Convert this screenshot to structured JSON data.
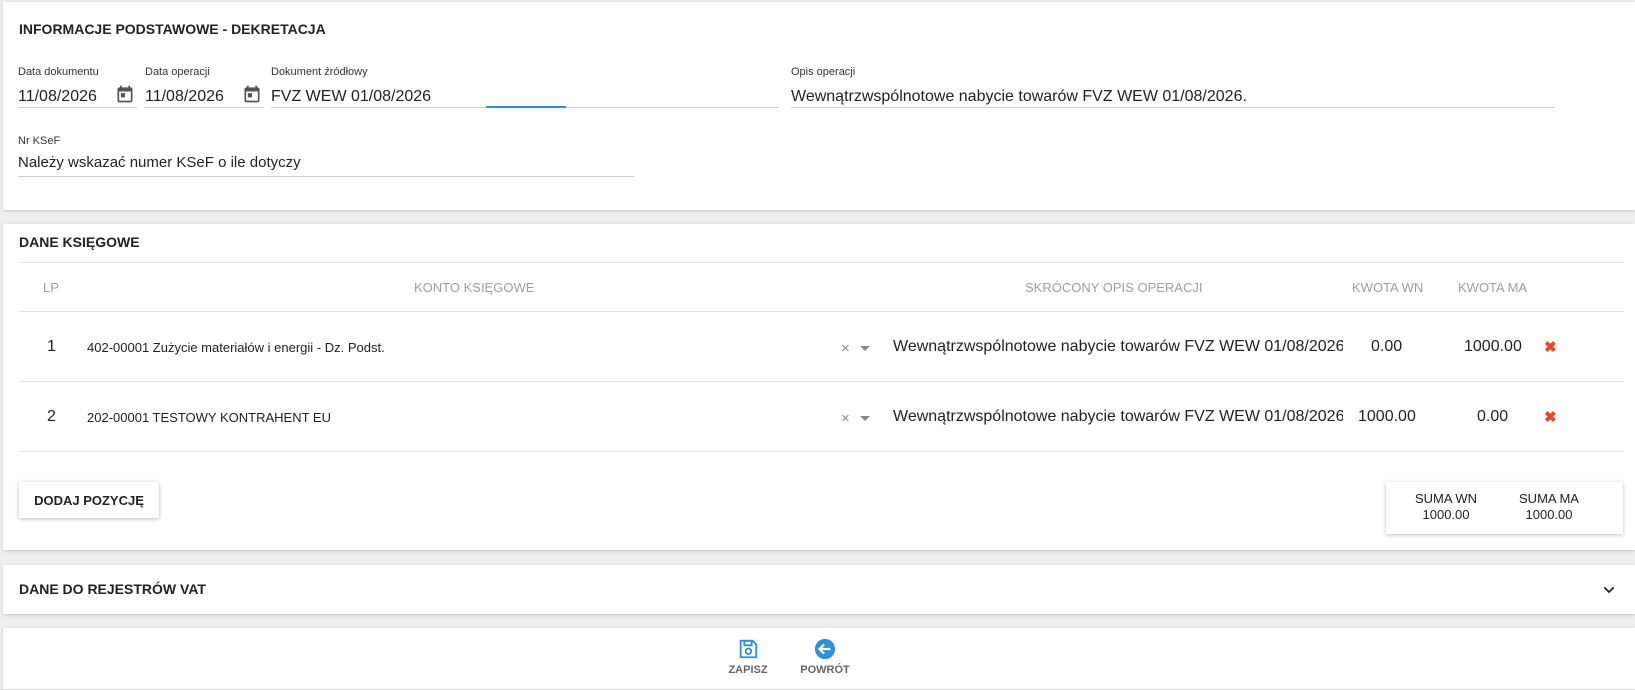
{
  "basic_info": {
    "title": "INFORMACJE PODSTAWOWE - DEKRETACJA",
    "doc_date": {
      "label": "Data dokumentu",
      "value": "11/08/2026"
    },
    "op_date": {
      "label": "Data operacji",
      "value": "11/08/2026"
    },
    "source_doc": {
      "label": "Dokument źródłowy",
      "value": "FVZ WEW 01/08/2026"
    },
    "op_desc": {
      "label": "Opis operacji",
      "value": "Wewnątrzwspólnotowe nabycie towarów FVZ WEW 01/08/2026."
    },
    "ksef": {
      "label": "Nr KSeF",
      "placeholder": "Należy wskazać numer KSeF o ile dotyczy"
    }
  },
  "accounting": {
    "title": "DANE KSIĘGOWE",
    "columns": {
      "lp": "LP",
      "account": "KONTO KSIĘGOWE",
      "desc": "SKRÓCONY OPIS OPERACJI",
      "wn": "KWOTA WN",
      "ma": "KWOTA MA"
    },
    "rows": [
      {
        "lp": "1",
        "account": "402-00001 Zużycie materiałów i energii - Dz. Podst.",
        "desc": "Wewnątrzwspólnotowe nabycie towarów FVZ WEW 01/08/2026.",
        "wn": "0.00",
        "ma": "1000.00"
      },
      {
        "lp": "2",
        "account": "202-00001 TESTOWY KONTRAHENT EU",
        "desc": "Wewnątrzwspólnotowe nabycie towarów FVZ WEW 01/08/2026.",
        "wn": "1000.00",
        "ma": "0.00"
      }
    ],
    "add_button": "DODAJ POZYCJĘ",
    "sum_wn_label": "SUMA WN",
    "sum_wn_value": "1000.00",
    "sum_ma_label": "SUMA MA",
    "sum_ma_value": "1000.00"
  },
  "vat": {
    "title": "DANE DO REJESTRÓW VAT"
  },
  "actions": {
    "save": "ZAPISZ",
    "back": "POWRÓT"
  },
  "colors": {
    "accent": "#2f8fd8",
    "delete": "#f0441c"
  },
  "icons": [
    "calendar-icon",
    "clear-icon",
    "dropdown-caret-icon",
    "delete-icon",
    "chevron-down-icon",
    "save-icon",
    "back-icon"
  ]
}
